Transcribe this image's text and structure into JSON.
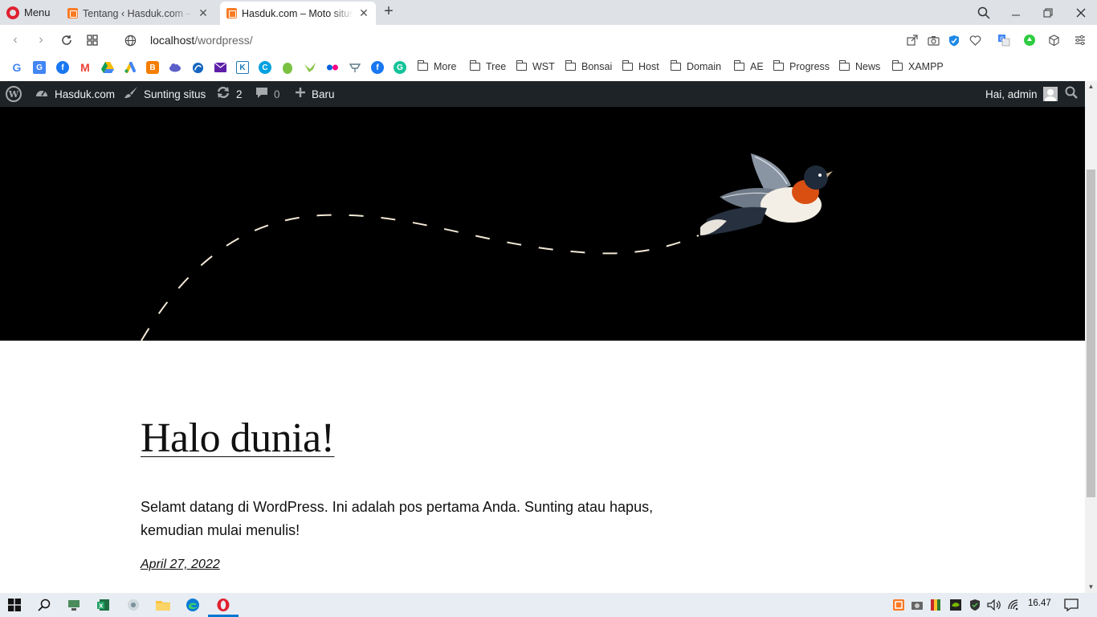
{
  "browser": {
    "menu_label": "Menu",
    "tabs": [
      {
        "title": "Tentang ‹ Hasduk.com — WordPress",
        "active": false
      },
      {
        "title": "Hasduk.com – Moto situs Anda",
        "active": true
      }
    ],
    "url_host": "localhost",
    "url_path": "/wordpress/",
    "bookmark_folders": [
      "More",
      "Tree",
      "WST",
      "Bonsai",
      "Host",
      "Domain",
      "AE",
      "Progress",
      "News",
      "XAMPP"
    ],
    "bookmark_icons": [
      "google-icon",
      "google-translate-icon",
      "facebook-icon",
      "gmail-icon",
      "google-drive-icon",
      "google-ads-icon",
      "blogger-icon",
      "cloud-icon",
      "app-icon",
      "mail-icon",
      "kinemaster-icon",
      "canva-icon",
      "evernote-icon",
      "bird-icon",
      "flickr-icon",
      "tool-icon",
      "facebook-icon",
      "grammarly-icon"
    ]
  },
  "wp_admin_bar": {
    "site_name": "Hasduk.com",
    "customize_label": "Sunting situs",
    "updates_count": "2",
    "comments_count": "0",
    "new_label": "Baru",
    "greeting": "Hai, admin"
  },
  "post": {
    "title": "Halo dunia!",
    "excerpt": "Selamt datang di WordPress. Ini adalah pos pertama Anda. Sunting atau hapus, kemudian mulai menulis!",
    "date": "April 27, 2022"
  },
  "taskbar": {
    "clock": "16.47"
  },
  "colors": {
    "wp_admin_bg": "#1d2327",
    "hero_bg": "#000000",
    "tab_strip_bg": "#dee1e6",
    "taskbar_bg": "#e8edf3"
  }
}
